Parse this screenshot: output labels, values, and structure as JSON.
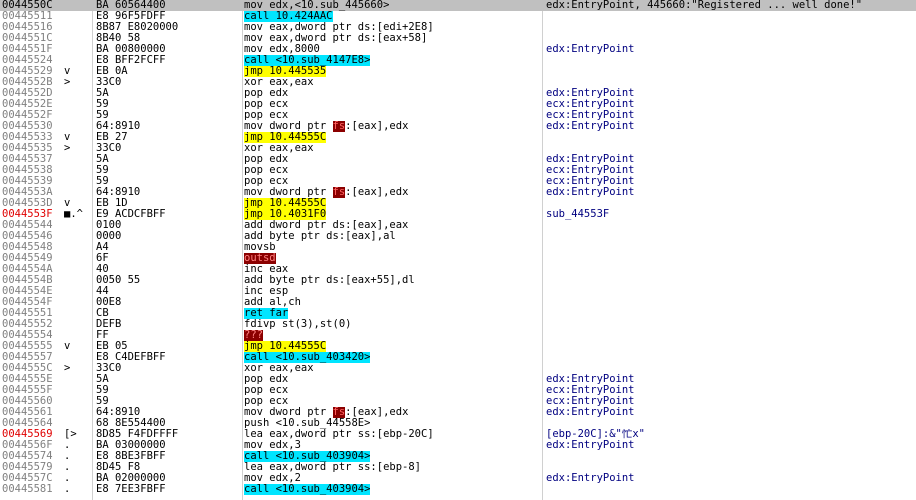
{
  "colors": {
    "call_hl": "#00e5ff",
    "jmp_hl": "#ffff00",
    "bad_hl": "#8b0000",
    "selected_row": "#c0c0c0",
    "red_addr": "#e00000"
  },
  "rows": [
    {
      "addr": "0044550C",
      "gut": "",
      "bytes": "BA 60564400",
      "kind": "plain",
      "instr": "mov edx,<10.sub_445660>",
      "cmt": "edx:EntryPoint, 445660:\"Registered ... well done!\"",
      "sel": true
    },
    {
      "addr": "00445511",
      "gut": "",
      "bytes": "E8 96F5FDFF",
      "kind": "call",
      "instr": "call 10.424AAC",
      "cmt": ""
    },
    {
      "addr": "00445516",
      "gut": "",
      "bytes": "8B87 E8020000",
      "kind": "plain",
      "instr": "mov eax,dword ptr ds:[edi+2E8]",
      "cmt": ""
    },
    {
      "addr": "0044551C",
      "gut": "",
      "bytes": "8B40 58",
      "kind": "plain",
      "instr": "mov eax,dword ptr ds:[eax+58]",
      "cmt": ""
    },
    {
      "addr": "0044551F",
      "gut": "",
      "bytes": "BA 00800000",
      "kind": "plain",
      "instr": "mov edx,8000",
      "cmt": "edx:EntryPoint"
    },
    {
      "addr": "00445524",
      "gut": "",
      "bytes": "E8 BFF2FCFF",
      "kind": "call",
      "instr": "call <10.sub_4147E8>",
      "cmt": ""
    },
    {
      "addr": "00445529",
      "gut": "v",
      "bytes": "EB 0A",
      "kind": "jmp",
      "instr": "jmp 10.445535",
      "cmt": ""
    },
    {
      "addr": "0044552B",
      "gut": ">",
      "bytes": "33C0",
      "kind": "plain",
      "instr": "xor eax,eax",
      "cmt": ""
    },
    {
      "addr": "0044552D",
      "gut": "",
      "bytes": "5A",
      "kind": "plain",
      "instr": "pop edx",
      "cmt": "edx:EntryPoint"
    },
    {
      "addr": "0044552E",
      "gut": "",
      "bytes": "59",
      "kind": "plain",
      "instr": "pop ecx",
      "cmt": "ecx:EntryPoint"
    },
    {
      "addr": "0044552F",
      "gut": "",
      "bytes": "59",
      "kind": "plain",
      "instr": "pop ecx",
      "cmt": "ecx:EntryPoint"
    },
    {
      "addr": "00445530",
      "gut": "",
      "bytes": "64:8910",
      "kind": "seg",
      "pre": "mov dword ptr ",
      "seg": "fs",
      "post": ":[eax],edx",
      "cmt": "edx:EntryPoint"
    },
    {
      "addr": "00445533",
      "gut": "v",
      "bytes": "EB 27",
      "kind": "jmp",
      "instr": "jmp 10.44555C",
      "cmt": ""
    },
    {
      "addr": "00445535",
      "gut": ">",
      "bytes": "33C0",
      "kind": "plain",
      "instr": "xor eax,eax",
      "cmt": ""
    },
    {
      "addr": "00445537",
      "gut": "",
      "bytes": "5A",
      "kind": "plain",
      "instr": "pop edx",
      "cmt": "edx:EntryPoint"
    },
    {
      "addr": "00445538",
      "gut": "",
      "bytes": "59",
      "kind": "plain",
      "instr": "pop ecx",
      "cmt": "ecx:EntryPoint"
    },
    {
      "addr": "00445539",
      "gut": "",
      "bytes": "59",
      "kind": "plain",
      "instr": "pop ecx",
      "cmt": "ecx:EntryPoint"
    },
    {
      "addr": "0044553A",
      "gut": "",
      "bytes": "64:8910",
      "kind": "seg",
      "pre": "mov dword ptr ",
      "seg": "fs",
      "post": ":[eax],edx",
      "cmt": "edx:EntryPoint"
    },
    {
      "addr": "0044553D",
      "gut": "v",
      "bytes": "EB 1D",
      "kind": "jmp",
      "instr": "jmp 10.44555C",
      "cmt": ""
    },
    {
      "addr": "0044553F",
      "gut": "■.^",
      "bytes": "E9 ACDCFBFF",
      "kind": "jmp",
      "instr": "jmp 10.4031F0",
      "cmt": "sub_44553F",
      "red": true
    },
    {
      "addr": "00445544",
      "gut": "",
      "bytes": "0100",
      "kind": "plain",
      "instr": "add dword ptr ds:[eax],eax",
      "cmt": ""
    },
    {
      "addr": "00445546",
      "gut": "",
      "bytes": "0000",
      "kind": "plain",
      "instr": "add byte ptr ds:[eax],al",
      "cmt": ""
    },
    {
      "addr": "00445548",
      "gut": "",
      "bytes": "A4",
      "kind": "plain",
      "instr": "movsb",
      "cmt": ""
    },
    {
      "addr": "00445549",
      "gut": "",
      "bytes": "6F",
      "kind": "bad",
      "instr": "outsd",
      "cmt": ""
    },
    {
      "addr": "0044554A",
      "gut": "",
      "bytes": "40",
      "kind": "plain",
      "instr": "inc eax",
      "cmt": ""
    },
    {
      "addr": "0044554B",
      "gut": "",
      "bytes": "0050 55",
      "kind": "plain",
      "instr": "add byte ptr ds:[eax+55],dl",
      "cmt": ""
    },
    {
      "addr": "0044554E",
      "gut": "",
      "bytes": "44",
      "kind": "plain",
      "instr": "inc esp",
      "cmt": ""
    },
    {
      "addr": "0044554F",
      "gut": "",
      "bytes": "00E8",
      "kind": "plain",
      "instr": "add al,ch",
      "cmt": ""
    },
    {
      "addr": "00445551",
      "gut": "",
      "bytes": "CB",
      "kind": "call",
      "instr": "ret far",
      "cmt": ""
    },
    {
      "addr": "00445552",
      "gut": "",
      "bytes": "DEFB",
      "kind": "plain",
      "instr": "fdivp st(3),st(0)",
      "cmt": ""
    },
    {
      "addr": "00445554",
      "gut": "",
      "bytes": "FF",
      "kind": "bad",
      "instr": "???",
      "cmt": ""
    },
    {
      "addr": "00445555",
      "gut": "v",
      "bytes": "EB 05",
      "kind": "jmp",
      "instr": "jmp 10.44555C",
      "cmt": ""
    },
    {
      "addr": "00445557",
      "gut": "",
      "bytes": "E8 C4DEFBFF",
      "kind": "call",
      "instr": "call <10.sub_403420>",
      "cmt": ""
    },
    {
      "addr": "0044555C",
      "gut": ">",
      "bytes": "33C0",
      "kind": "plain",
      "instr": "xor eax,eax",
      "cmt": ""
    },
    {
      "addr": "0044555E",
      "gut": "",
      "bytes": "5A",
      "kind": "plain",
      "instr": "pop edx",
      "cmt": "edx:EntryPoint"
    },
    {
      "addr": "0044555F",
      "gut": "",
      "bytes": "59",
      "kind": "plain",
      "instr": "pop ecx",
      "cmt": "ecx:EntryPoint"
    },
    {
      "addr": "00445560",
      "gut": "",
      "bytes": "59",
      "kind": "plain",
      "instr": "pop ecx",
      "cmt": "ecx:EntryPoint"
    },
    {
      "addr": "00445561",
      "gut": "",
      "bytes": "64:8910",
      "kind": "seg",
      "pre": "mov dword ptr ",
      "seg": "fs",
      "post": ":[eax],edx",
      "cmt": "edx:EntryPoint"
    },
    {
      "addr": "00445564",
      "gut": "",
      "bytes": "68 8E554400",
      "kind": "plain",
      "instr": "push <10.sub_44558E>",
      "cmt": ""
    },
    {
      "addr": "00445569",
      "gut": "[>",
      "bytes": "8D85 F4FDFFFF",
      "kind": "plain",
      "instr": "lea eax,dword ptr ss:[ebp-20C]",
      "cmt": "[ebp-20C]:&\"忙x\"",
      "red": true
    },
    {
      "addr": "0044556F",
      "gut": ".",
      "bytes": "BA 03000000",
      "kind": "plain",
      "instr": "mov edx,3",
      "cmt": "edx:EntryPoint"
    },
    {
      "addr": "00445574",
      "gut": ".",
      "bytes": "E8 8BE3FBFF",
      "kind": "call",
      "instr": "call <10.sub_403904>",
      "cmt": ""
    },
    {
      "addr": "00445579",
      "gut": ".",
      "bytes": "8D45 F8",
      "kind": "plain",
      "instr": "lea eax,dword ptr ss:[ebp-8]",
      "cmt": ""
    },
    {
      "addr": "0044557C",
      "gut": ".",
      "bytes": "BA 02000000",
      "kind": "plain",
      "instr": "mov edx,2",
      "cmt": "edx:EntryPoint"
    },
    {
      "addr": "00445581",
      "gut": ".",
      "bytes": "E8 7EE3FBFF",
      "kind": "call",
      "instr": "call <10.sub_403904>",
      "cmt": ""
    }
  ]
}
